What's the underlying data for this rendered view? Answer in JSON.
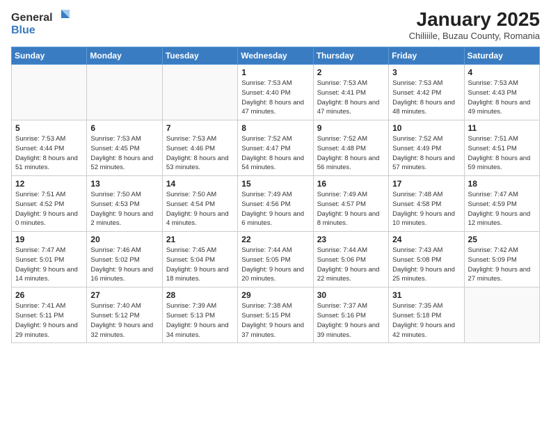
{
  "header": {
    "logo_general": "General",
    "logo_blue": "Blue",
    "title": "January 2025",
    "subtitle": "Chiliiile, Buzau County, Romania"
  },
  "weekdays": [
    "Sunday",
    "Monday",
    "Tuesday",
    "Wednesday",
    "Thursday",
    "Friday",
    "Saturday"
  ],
  "weeks": [
    [
      {
        "day": "",
        "info": ""
      },
      {
        "day": "",
        "info": ""
      },
      {
        "day": "",
        "info": ""
      },
      {
        "day": "1",
        "info": "Sunrise: 7:53 AM\nSunset: 4:40 PM\nDaylight: 8 hours and 47 minutes."
      },
      {
        "day": "2",
        "info": "Sunrise: 7:53 AM\nSunset: 4:41 PM\nDaylight: 8 hours and 47 minutes."
      },
      {
        "day": "3",
        "info": "Sunrise: 7:53 AM\nSunset: 4:42 PM\nDaylight: 8 hours and 48 minutes."
      },
      {
        "day": "4",
        "info": "Sunrise: 7:53 AM\nSunset: 4:43 PM\nDaylight: 8 hours and 49 minutes."
      }
    ],
    [
      {
        "day": "5",
        "info": "Sunrise: 7:53 AM\nSunset: 4:44 PM\nDaylight: 8 hours and 51 minutes."
      },
      {
        "day": "6",
        "info": "Sunrise: 7:53 AM\nSunset: 4:45 PM\nDaylight: 8 hours and 52 minutes."
      },
      {
        "day": "7",
        "info": "Sunrise: 7:53 AM\nSunset: 4:46 PM\nDaylight: 8 hours and 53 minutes."
      },
      {
        "day": "8",
        "info": "Sunrise: 7:52 AM\nSunset: 4:47 PM\nDaylight: 8 hours and 54 minutes."
      },
      {
        "day": "9",
        "info": "Sunrise: 7:52 AM\nSunset: 4:48 PM\nDaylight: 8 hours and 56 minutes."
      },
      {
        "day": "10",
        "info": "Sunrise: 7:52 AM\nSunset: 4:49 PM\nDaylight: 8 hours and 57 minutes."
      },
      {
        "day": "11",
        "info": "Sunrise: 7:51 AM\nSunset: 4:51 PM\nDaylight: 8 hours and 59 minutes."
      }
    ],
    [
      {
        "day": "12",
        "info": "Sunrise: 7:51 AM\nSunset: 4:52 PM\nDaylight: 9 hours and 0 minutes."
      },
      {
        "day": "13",
        "info": "Sunrise: 7:50 AM\nSunset: 4:53 PM\nDaylight: 9 hours and 2 minutes."
      },
      {
        "day": "14",
        "info": "Sunrise: 7:50 AM\nSunset: 4:54 PM\nDaylight: 9 hours and 4 minutes."
      },
      {
        "day": "15",
        "info": "Sunrise: 7:49 AM\nSunset: 4:56 PM\nDaylight: 9 hours and 6 minutes."
      },
      {
        "day": "16",
        "info": "Sunrise: 7:49 AM\nSunset: 4:57 PM\nDaylight: 9 hours and 8 minutes."
      },
      {
        "day": "17",
        "info": "Sunrise: 7:48 AM\nSunset: 4:58 PM\nDaylight: 9 hours and 10 minutes."
      },
      {
        "day": "18",
        "info": "Sunrise: 7:47 AM\nSunset: 4:59 PM\nDaylight: 9 hours and 12 minutes."
      }
    ],
    [
      {
        "day": "19",
        "info": "Sunrise: 7:47 AM\nSunset: 5:01 PM\nDaylight: 9 hours and 14 minutes."
      },
      {
        "day": "20",
        "info": "Sunrise: 7:46 AM\nSunset: 5:02 PM\nDaylight: 9 hours and 16 minutes."
      },
      {
        "day": "21",
        "info": "Sunrise: 7:45 AM\nSunset: 5:04 PM\nDaylight: 9 hours and 18 minutes."
      },
      {
        "day": "22",
        "info": "Sunrise: 7:44 AM\nSunset: 5:05 PM\nDaylight: 9 hours and 20 minutes."
      },
      {
        "day": "23",
        "info": "Sunrise: 7:44 AM\nSunset: 5:06 PM\nDaylight: 9 hours and 22 minutes."
      },
      {
        "day": "24",
        "info": "Sunrise: 7:43 AM\nSunset: 5:08 PM\nDaylight: 9 hours and 25 minutes."
      },
      {
        "day": "25",
        "info": "Sunrise: 7:42 AM\nSunset: 5:09 PM\nDaylight: 9 hours and 27 minutes."
      }
    ],
    [
      {
        "day": "26",
        "info": "Sunrise: 7:41 AM\nSunset: 5:11 PM\nDaylight: 9 hours and 29 minutes."
      },
      {
        "day": "27",
        "info": "Sunrise: 7:40 AM\nSunset: 5:12 PM\nDaylight: 9 hours and 32 minutes."
      },
      {
        "day": "28",
        "info": "Sunrise: 7:39 AM\nSunset: 5:13 PM\nDaylight: 9 hours and 34 minutes."
      },
      {
        "day": "29",
        "info": "Sunrise: 7:38 AM\nSunset: 5:15 PM\nDaylight: 9 hours and 37 minutes."
      },
      {
        "day": "30",
        "info": "Sunrise: 7:37 AM\nSunset: 5:16 PM\nDaylight: 9 hours and 39 minutes."
      },
      {
        "day": "31",
        "info": "Sunrise: 7:35 AM\nSunset: 5:18 PM\nDaylight: 9 hours and 42 minutes."
      },
      {
        "day": "",
        "info": ""
      }
    ]
  ]
}
